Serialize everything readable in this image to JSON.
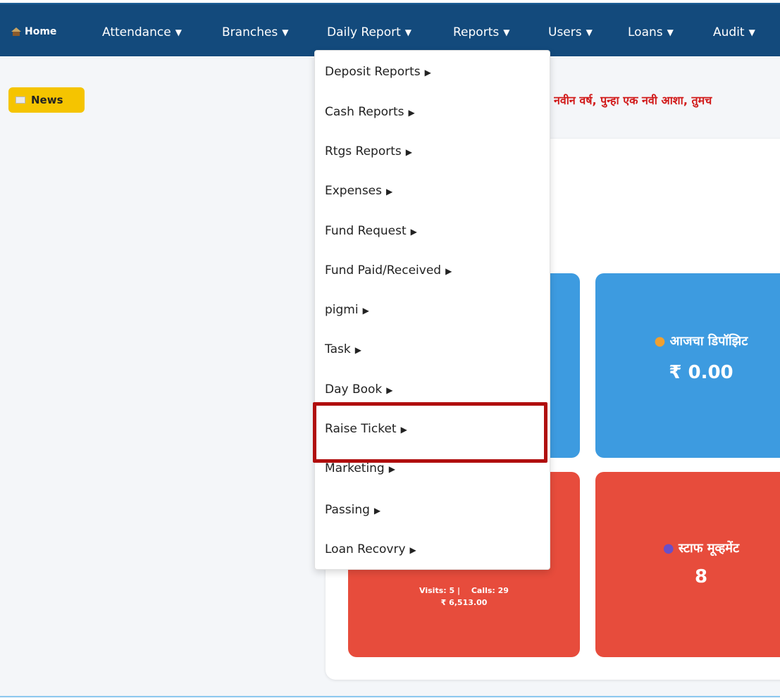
{
  "nav": {
    "home": "Home",
    "items": [
      {
        "label": "Attendance"
      },
      {
        "label": "Branches"
      },
      {
        "label": "Daily Report"
      },
      {
        "label": "Reports"
      },
      {
        "label": "Users"
      },
      {
        "label": "Loans"
      },
      {
        "label": "Audit"
      }
    ],
    "caret": "▼"
  },
  "news": {
    "label": "News",
    "ticker": "नवीन वर्ष, पुन्हा एक नवी आशा, तुमच"
  },
  "dropdown": {
    "arrow": "▶",
    "items": [
      "Deposit Reports",
      "Cash Reports",
      "Rtgs Reports",
      "Expenses",
      "Fund Request",
      "Fund Paid/Received",
      "pigmi",
      "Task",
      "Day Book",
      "Raise Ticket",
      "Marketing",
      "Passing",
      "Loan Recovry"
    ],
    "highlighted": "Raise Ticket"
  },
  "cards": {
    "deposit": {
      "icon": "money-bag-icon",
      "title": "आजचा डिपॉझिट",
      "value": "₹ 0.00"
    },
    "staff": {
      "icon": "people-icon",
      "title": "स्टाफ मूव्हमेंट",
      "value": "8"
    },
    "marketing": {
      "visits": "Visits: 5 |",
      "calls": "Calls: 29",
      "amount": "₹ 6,513.00"
    }
  },
  "colors": {
    "nav_bg": "#134a7c",
    "card_blue": "#3d9be0",
    "card_red": "#e74c3c",
    "news_bg": "#f5c400",
    "highlight": "#b00e0e",
    "ticker": "#d11a1a"
  }
}
